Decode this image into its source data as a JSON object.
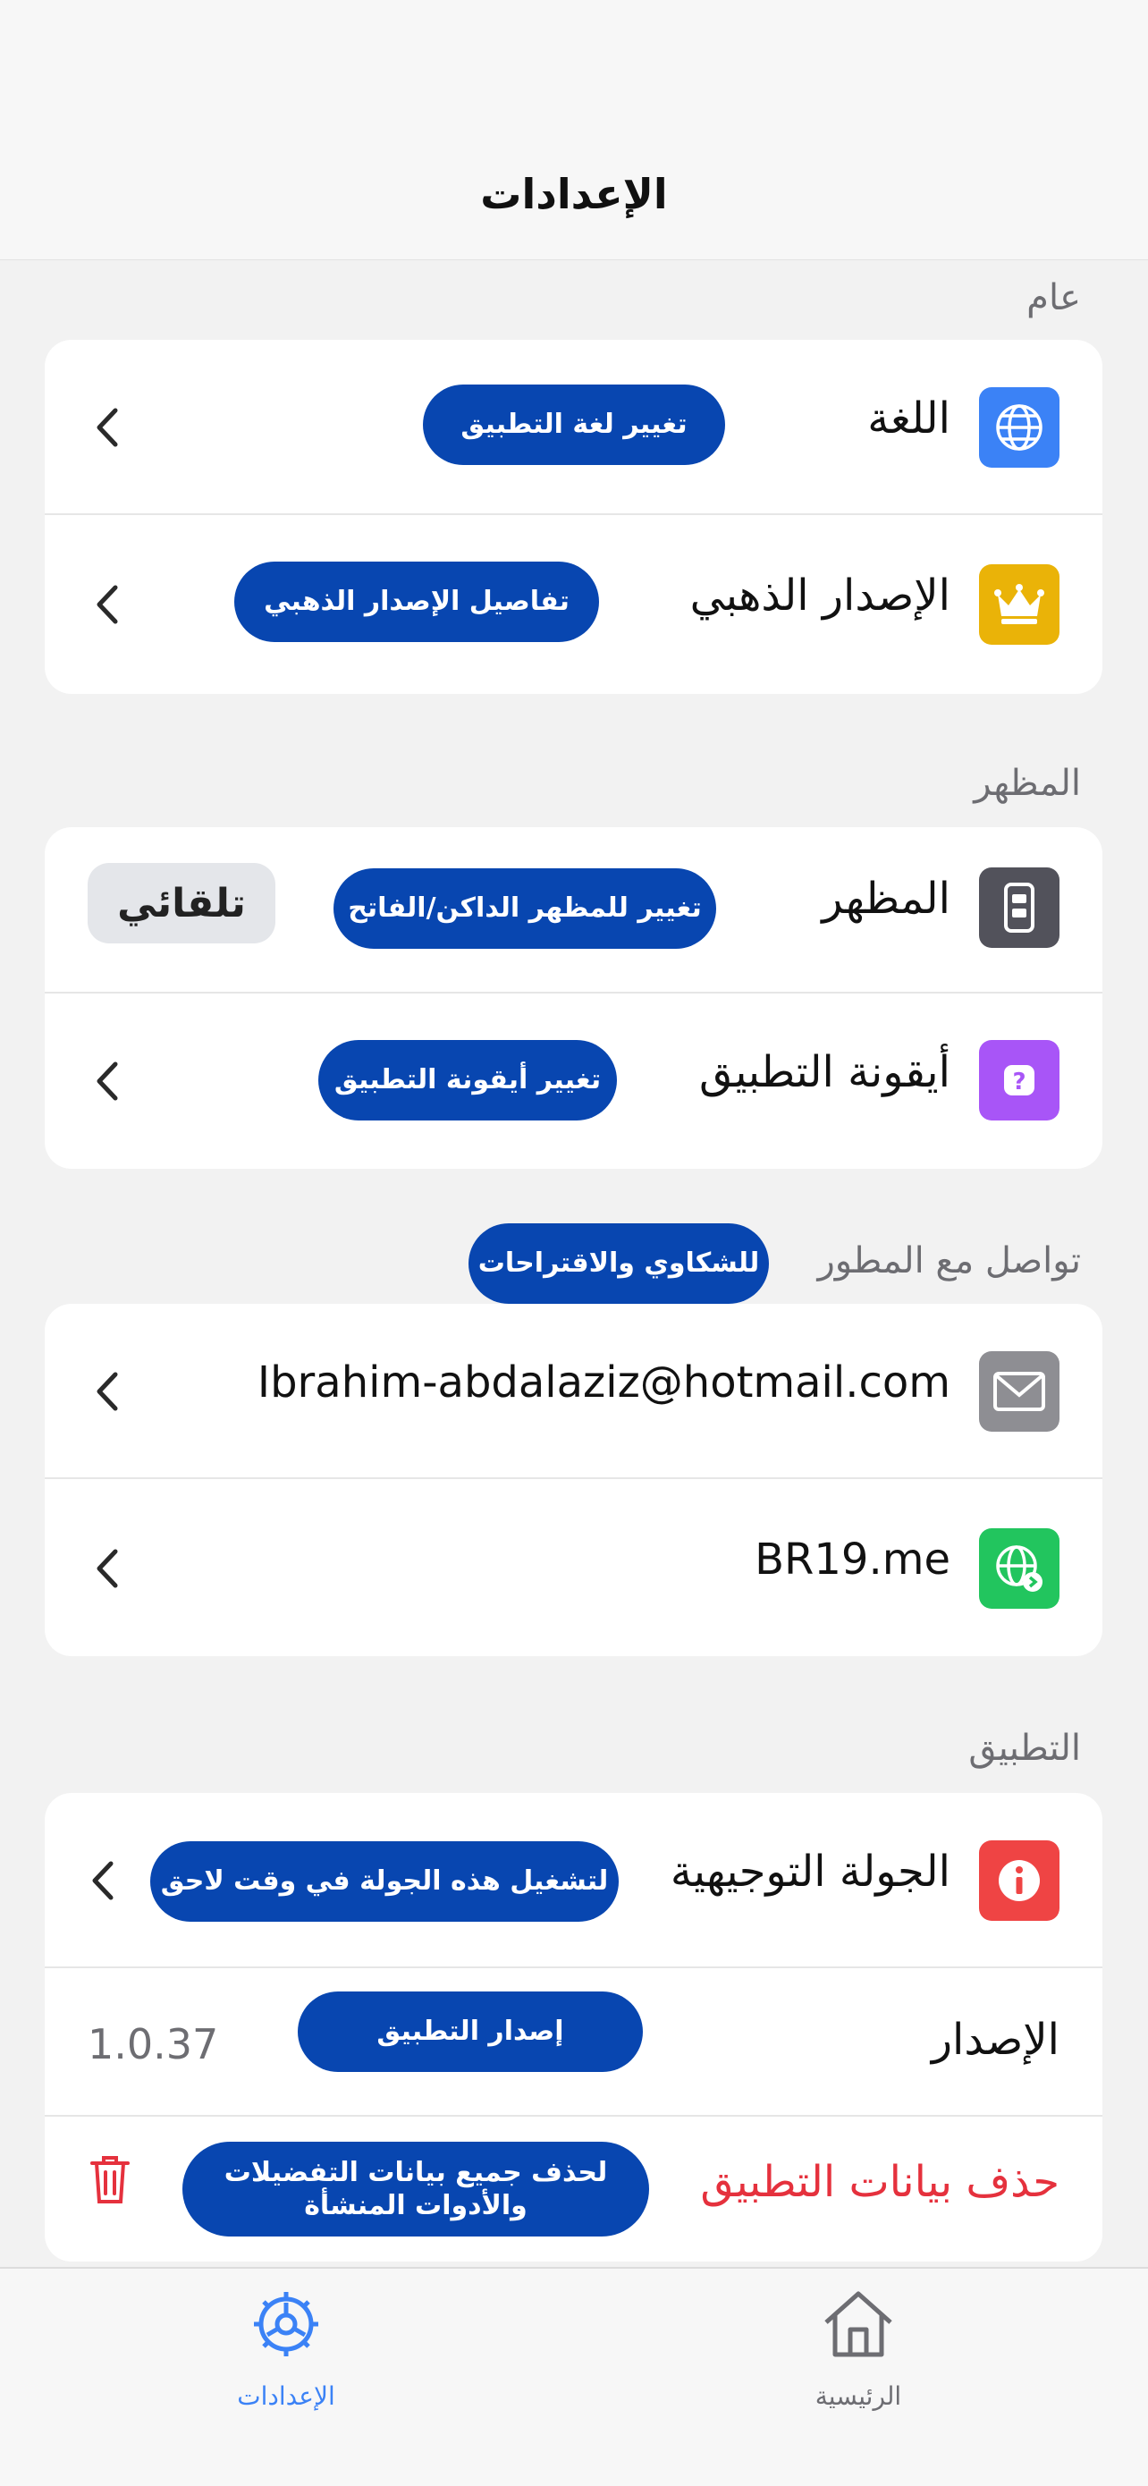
{
  "header": {
    "title": "الإعدادات"
  },
  "sections": {
    "general": {
      "title": "عام",
      "language": {
        "label": "اللغة",
        "tip": "تغيير لغة التطبيق",
        "icon": "globe-icon",
        "color": "#3b82f6"
      },
      "gold": {
        "label": "الإصدار الذهبي",
        "tip": "تفاصيل الإصدار الذهبي",
        "icon": "crown-icon",
        "color": "#eab308"
      }
    },
    "appearance": {
      "title": "المظهر",
      "theme": {
        "label": "المظهر",
        "tip": "تغيير للمظهر الداكن/الفاتح",
        "value": "تلقائي",
        "icon": "phone-theme-icon",
        "color": "#52525b"
      },
      "app_icon": {
        "label": "أيقونة التطبيق",
        "tip": "تغيير أيقونة التطبيق",
        "icon": "app-icon-icon",
        "color": "#a855f7"
      }
    },
    "contact": {
      "title": "تواصل مع المطور",
      "tip": "للشكاوي والاقتراحات",
      "email": {
        "label": "Ibrahim-abdalaziz@hotmail.com",
        "icon": "envelope-icon",
        "color": "#8e8e93"
      },
      "website": {
        "label": "BR19.me",
        "icon": "web-icon",
        "color": "#22c55e"
      }
    },
    "app": {
      "title": "التطبيق",
      "tour": {
        "label": "الجولة التوجيهية",
        "tip": "لتشغيل هذه الجولة في وقت لاحق",
        "icon": "info-icon",
        "color": "#ef4444"
      },
      "version": {
        "label": "الإصدار",
        "tip": "إصدار التطبيق",
        "value": "1.0.37"
      },
      "delete": {
        "label": "حذف بيانات التطبيق",
        "tip_line1": "لحذف جميع بيانات التفضيلات",
        "tip_line2": "والأدوات المنشأة",
        "color": "#e5313d"
      }
    }
  },
  "tabbar": {
    "settings_label": "الإعدادات",
    "home_label": "الرئيسية",
    "active_color": "#3b82f6",
    "inactive_color": "#6d6d72"
  }
}
